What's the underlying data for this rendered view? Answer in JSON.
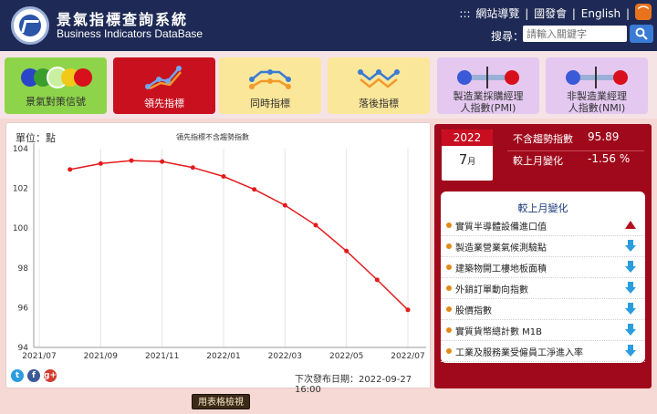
{
  "header": {
    "title_zh": "景氣指標查詢系統",
    "title_en": "Business Indicators DataBase",
    "nav_separator": ":::",
    "nav": [
      "網站導覽",
      "國發會",
      "English"
    ],
    "search_label": "搜尋：",
    "search_placeholder": "請輸入關鍵字"
  },
  "tabs": [
    {
      "label": "景氣對策信號",
      "bg": "#8ed44a",
      "icon": "signal-lights-icon"
    },
    {
      "label": "領先指標",
      "bg": "#c8101f",
      "icon": "leading-line-icon",
      "active": true
    },
    {
      "label": "同時指標",
      "bg": "#fbe79a",
      "icon": "coincident-line-icon"
    },
    {
      "label": "落後指標",
      "bg": "#fbe79a",
      "icon": "lagging-line-icon"
    },
    {
      "label": "製造業採購經理\n人指數(PMI)",
      "bg": "#e4c8f0",
      "icon": "pmi-thermometer-icon"
    },
    {
      "label": "非製造業經理\n人指數(NMI)",
      "bg": "#e4c8f0",
      "icon": "nmi-thermometer-icon"
    }
  ],
  "chart": {
    "unit_label": "單位：點",
    "next_release": "下次發布日期：2022-09-27 16:00"
  },
  "chart_data": {
    "type": "line",
    "title": "領先指標不含趨勢指數",
    "xlabel": "",
    "ylabel": "",
    "x": [
      "2021/08",
      "2021/09",
      "2021/10",
      "2021/11",
      "2021/12",
      "2022/01",
      "2022/02",
      "2022/03",
      "2022/04",
      "2022/05",
      "2022/06",
      "2022/07"
    ],
    "series": [
      {
        "name": "",
        "values": [
          102.95,
          103.25,
          103.4,
          103.35,
          103.05,
          102.6,
          101.95,
          101.15,
          100.15,
          98.85,
          97.4,
          95.89
        ],
        "color": "#e31a1c"
      }
    ],
    "x_tick_labels": [
      "2021/07",
      "2021/09",
      "2021/11",
      "2022/01",
      "2022/03",
      "2022/05",
      "2022/07"
    ],
    "y_ticks": [
      94,
      96,
      98,
      100,
      102,
      104
    ],
    "ylim": [
      94,
      104
    ],
    "grid": "vertical"
  },
  "side": {
    "year": "2022",
    "month": "7",
    "month_suffix": "月",
    "index_label": "不含趨勢指數",
    "index_value": "95.89",
    "mom_label": "較上月變化",
    "mom_value": "-1.56 %",
    "change_title": "較上月變化",
    "components": [
      {
        "label": "實質半導體設備進口值",
        "direction": "up"
      },
      {
        "label": "製造業營業氣候測驗點",
        "direction": "down"
      },
      {
        "label": "建築物開工樓地板面積",
        "direction": "down"
      },
      {
        "label": "外銷訂單動向指數",
        "direction": "down"
      },
      {
        "label": "股價指數",
        "direction": "down"
      },
      {
        "label": "實質貨幣總計數 M1B",
        "direction": "down"
      },
      {
        "label": "工業及服務業受僱員工淨進入率",
        "direction": "down"
      }
    ]
  },
  "table_button": "用表格檢視",
  "colors": {
    "header": "#1e2a55",
    "accent_red": "#a0091b",
    "line": "#e31a1c",
    "up_arrow": "#b2101e",
    "down_arrow": "#2a9de0"
  }
}
